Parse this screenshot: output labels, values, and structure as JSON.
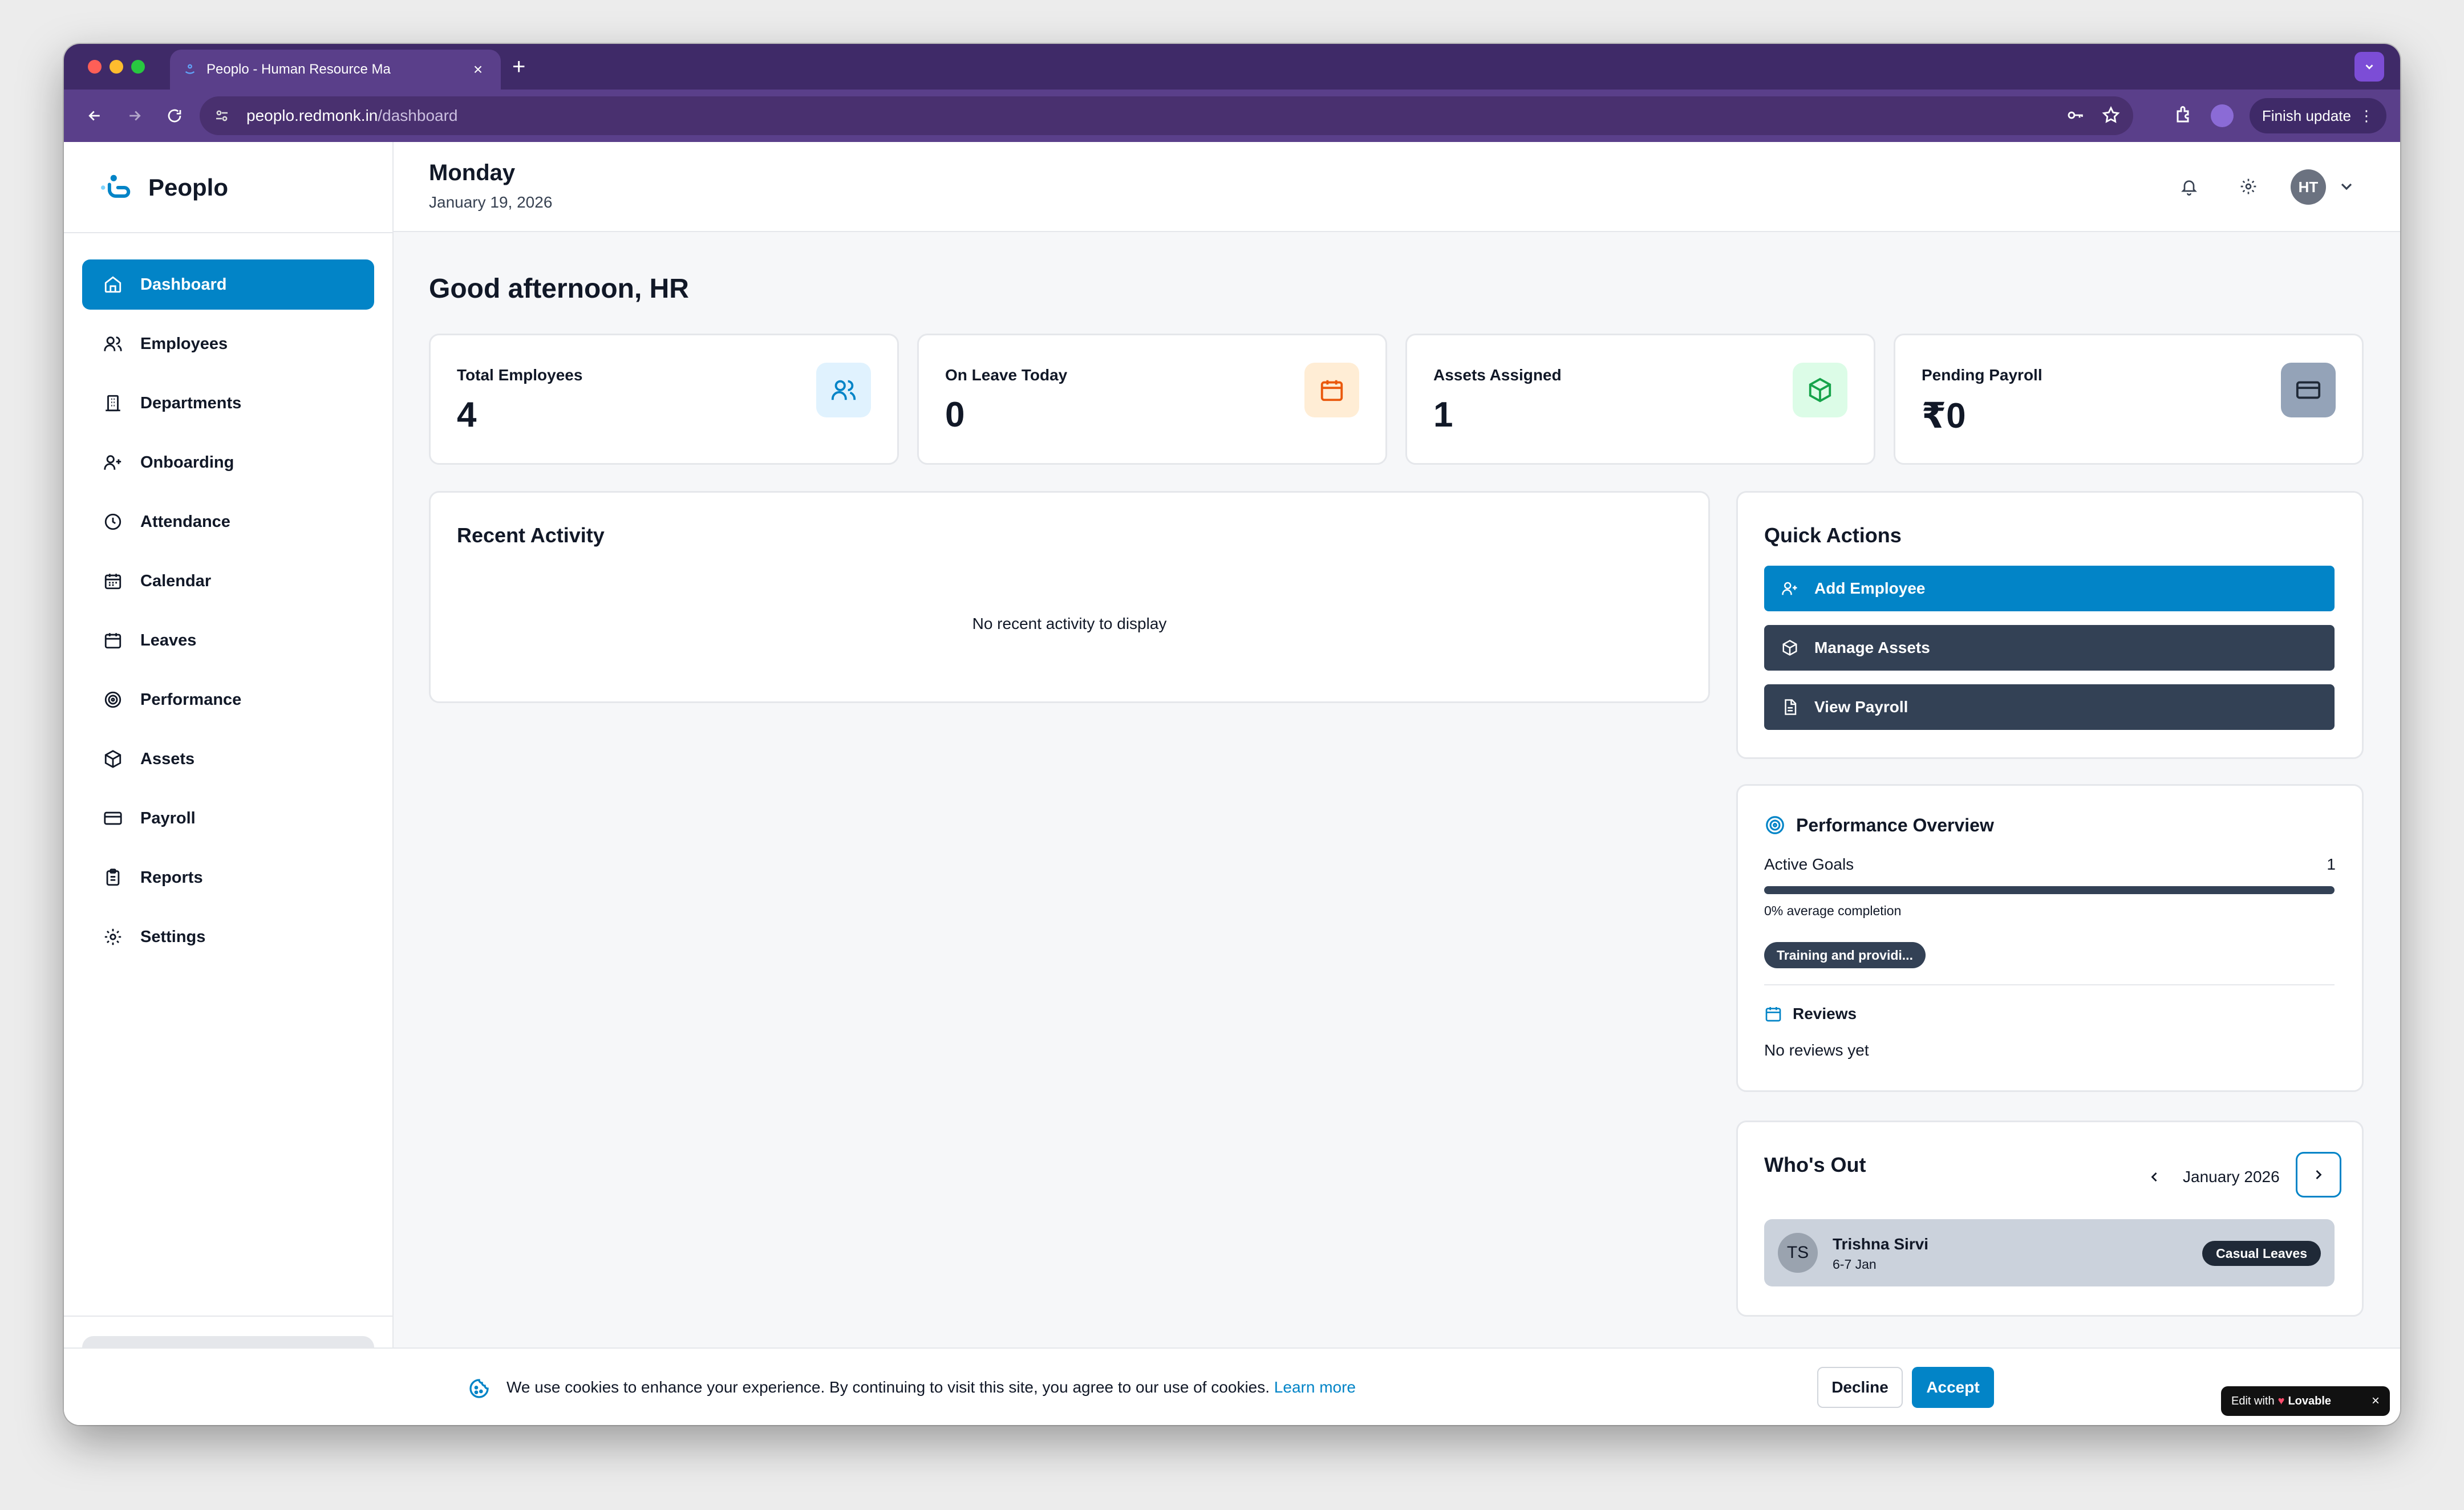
{
  "browser": {
    "tab_title": "Peoplo - Human Resource Ma",
    "url_host": "peoplo.redmonk.in",
    "url_path": "/dashboard",
    "finish_update_label": "Finish update"
  },
  "brand": {
    "name": "Peoplo"
  },
  "sidebar": {
    "items": [
      {
        "label": "Dashboard",
        "icon": "home-icon",
        "active": true
      },
      {
        "label": "Employees",
        "icon": "users-icon"
      },
      {
        "label": "Departments",
        "icon": "building-icon"
      },
      {
        "label": "Onboarding",
        "icon": "user-plus-icon"
      },
      {
        "label": "Attendance",
        "icon": "clock-icon"
      },
      {
        "label": "Calendar",
        "icon": "calendar-days-icon"
      },
      {
        "label": "Leaves",
        "icon": "calendar-icon"
      },
      {
        "label": "Performance",
        "icon": "target-icon"
      },
      {
        "label": "Assets",
        "icon": "package-icon"
      },
      {
        "label": "Payroll",
        "icon": "credit-card-icon"
      },
      {
        "label": "Reports",
        "icon": "clipboard-icon"
      },
      {
        "label": "Settings",
        "icon": "gear-icon"
      }
    ]
  },
  "header": {
    "day": "Monday",
    "date": "January 19, 2026",
    "avatar_initials": "HT"
  },
  "main": {
    "greeting": "Good afternoon, HR",
    "stats": [
      {
        "label": "Total Employees",
        "value": "4",
        "icon": "users-icon",
        "color": "#0284c7",
        "bg": "#e0f2fe"
      },
      {
        "label": "On Leave Today",
        "value": "0",
        "icon": "calendar-icon",
        "color": "#ea580c",
        "bg": "#ffedd5"
      },
      {
        "label": "Assets Assigned",
        "value": "1",
        "icon": "package-icon",
        "color": "#16a34a",
        "bg": "#dcfce7"
      },
      {
        "label": "Pending Payroll",
        "value": "₹0",
        "icon": "credit-card-icon",
        "color": "#1f2937",
        "bg": "#94a3b8"
      }
    ],
    "recent_activity": {
      "title": "Recent Activity",
      "empty": "No recent activity to display"
    },
    "quick_actions": {
      "title": "Quick Actions",
      "buttons": [
        {
          "label": "Add Employee",
          "icon": "user-plus-icon",
          "color": "#0284c7"
        },
        {
          "label": "Manage Assets",
          "icon": "package-icon",
          "color": "#334155"
        },
        {
          "label": "View Payroll",
          "icon": "file-icon",
          "color": "#334155"
        }
      ]
    },
    "performance": {
      "title": "Performance Overview",
      "active_goals_label": "Active Goals",
      "active_goals_value": "1",
      "completion_fraction": 0,
      "completion_text": "0% average completion",
      "goal_tag": "Training and providi...",
      "reviews_label": "Reviews",
      "reviews_empty": "No reviews yet"
    },
    "whos_out": {
      "title": "Who's Out",
      "month": "January 2026",
      "entries": [
        {
          "initials": "TS",
          "name": "Trishna Sirvi",
          "dates": "6-7 Jan",
          "type": "Casual Leaves"
        }
      ]
    }
  },
  "cookie": {
    "text": "We use cookies to enhance your experience. By continuing to visit this site, you agree to our use of cookies.",
    "learn_more": "Learn more",
    "decline": "Decline",
    "accept": "Accept"
  },
  "lovable": {
    "prefix": "Edit with",
    "brand": "Lovable"
  }
}
